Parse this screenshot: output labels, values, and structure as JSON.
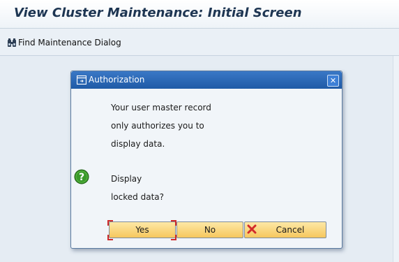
{
  "header": {
    "title": "View Cluster Maintenance: Initial Screen"
  },
  "toolbar": {
    "find_label": "Find Maintenance Dialog",
    "find_icon": "binoculars-icon"
  },
  "dialog": {
    "title": "Authorization",
    "title_icon": "window-icon",
    "close_icon": "close-icon",
    "message_lines": [
      "Your user master record",
      "only authorizes you to",
      "display data."
    ],
    "question_icon": "question-icon",
    "question_lines": [
      "Display",
      "locked data?"
    ],
    "buttons": {
      "yes": "Yes",
      "no": "No",
      "cancel": "Cancel",
      "cancel_icon": "cancel-x-icon"
    }
  },
  "colors": {
    "title_text": "#1d3552",
    "dialog_header": "#2563b0",
    "button": "#f8d577",
    "focus": "#d02a2a",
    "question": "#3a9a2a"
  }
}
